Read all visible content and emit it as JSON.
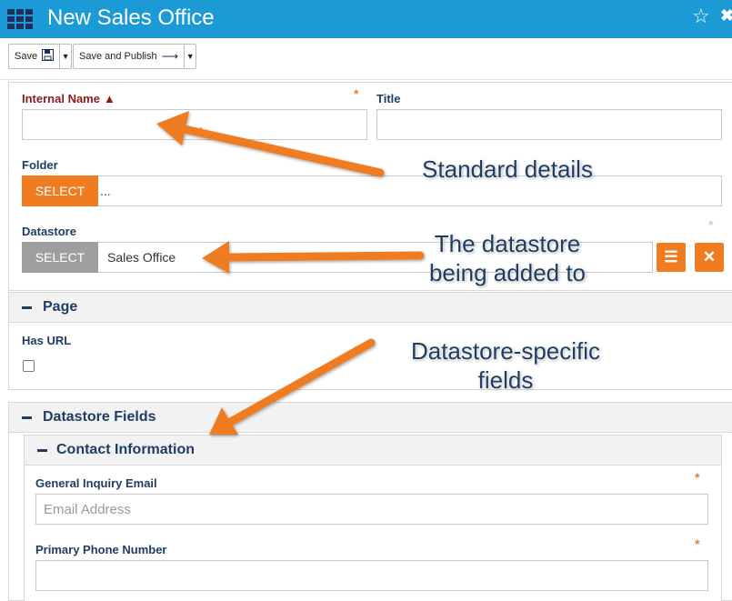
{
  "header": {
    "title": "New Sales Office",
    "apps_icon": "grid-icon",
    "star_icon": "star-icon",
    "close_icon": "close-icon"
  },
  "toolbar": {
    "save_label": "Save",
    "save_icon": "floppy-disk-icon",
    "save_publish_label": "Save and Publish",
    "save_publish_icon": "arrow-right-icon"
  },
  "form": {
    "internal_name_label": "Internal Name",
    "title_label": "Title",
    "folder_label": "Folder",
    "folder_select": "SELECT",
    "folder_value": "...",
    "datastore_label": "Datastore",
    "datastore_select": "SELECT",
    "datastore_value": "Sales Office",
    "required_mark": "*"
  },
  "page_section": {
    "title": "Page",
    "has_url_label": "Has URL",
    "has_url_checked": false
  },
  "datastore_fields": {
    "title": "Datastore Fields",
    "contact_title": "Contact Information",
    "email_label": "General Inquiry Email",
    "email_placeholder": "Email Address",
    "phone_label": "Primary Phone Number"
  },
  "annotations": {
    "standard": "Standard details",
    "datastore_line1": "The datastore",
    "datastore_line2": "being added to",
    "specific_line1": "Datastore-specific",
    "specific_line2": "fields"
  },
  "colors": {
    "header": "#1c9ad6",
    "accent": "#f07c21",
    "label": "#1f3d63",
    "required": "#8b1a1a"
  }
}
